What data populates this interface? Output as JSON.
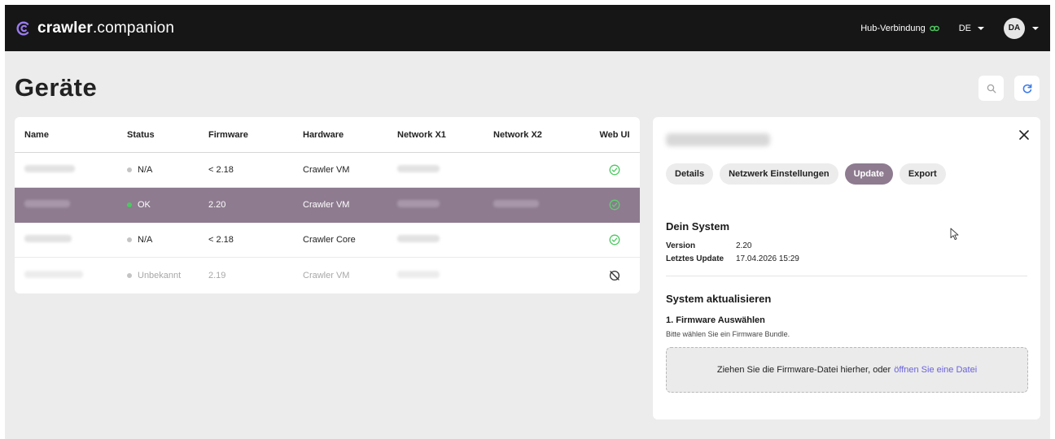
{
  "app": {
    "logo_bold": "crawler",
    "logo_rest": ".companion",
    "hub_label": "Hub-Verbindung",
    "language": "DE",
    "user_initials": "DA"
  },
  "page": {
    "title": "Geräte"
  },
  "table": {
    "columns": [
      "Name",
      "Status",
      "Firmware",
      "Hardware",
      "Network X1",
      "Network X2",
      "Web UI"
    ],
    "rows": [
      {
        "status": "N/A",
        "firmware": "< 2.18",
        "hardware": "Crawler VM"
      },
      {
        "status": "OK",
        "firmware": "2.20",
        "hardware": "Crawler VM"
      },
      {
        "status": "N/A",
        "firmware": "< 2.18",
        "hardware": "Crawler Core"
      },
      {
        "status": "Unbekannt",
        "firmware": "2.19",
        "hardware": "Crawler VM"
      }
    ]
  },
  "panel": {
    "tabs": [
      "Details",
      "Netzwerk Einstellungen",
      "Update",
      "Export"
    ],
    "system_title": "Dein System",
    "version_label": "Version",
    "version_value": "2.20",
    "last_update_label": "Letztes Update",
    "last_update_value": "17.04.2026 15:29",
    "update_title": "System aktualisieren",
    "step_title": "1. Firmware Auswählen",
    "step_hint": "Bitte wählen Sie ein Firmware Bundle.",
    "dropzone_text": "Ziehen Sie die Firmware-Datei hierher, oder",
    "dropzone_link": "öffnen Sie eine Datei"
  },
  "colors": {
    "accent": "#8e7b90",
    "link": "#6b63d9",
    "success": "#4cc960",
    "topbar": "#161616"
  },
  "icons": [
    "logo-icon",
    "link-icon",
    "chevron-down-icon",
    "search-icon",
    "refresh-icon",
    "check-circle-icon",
    "offline-icon",
    "close-icon",
    "cursor-icon"
  ]
}
